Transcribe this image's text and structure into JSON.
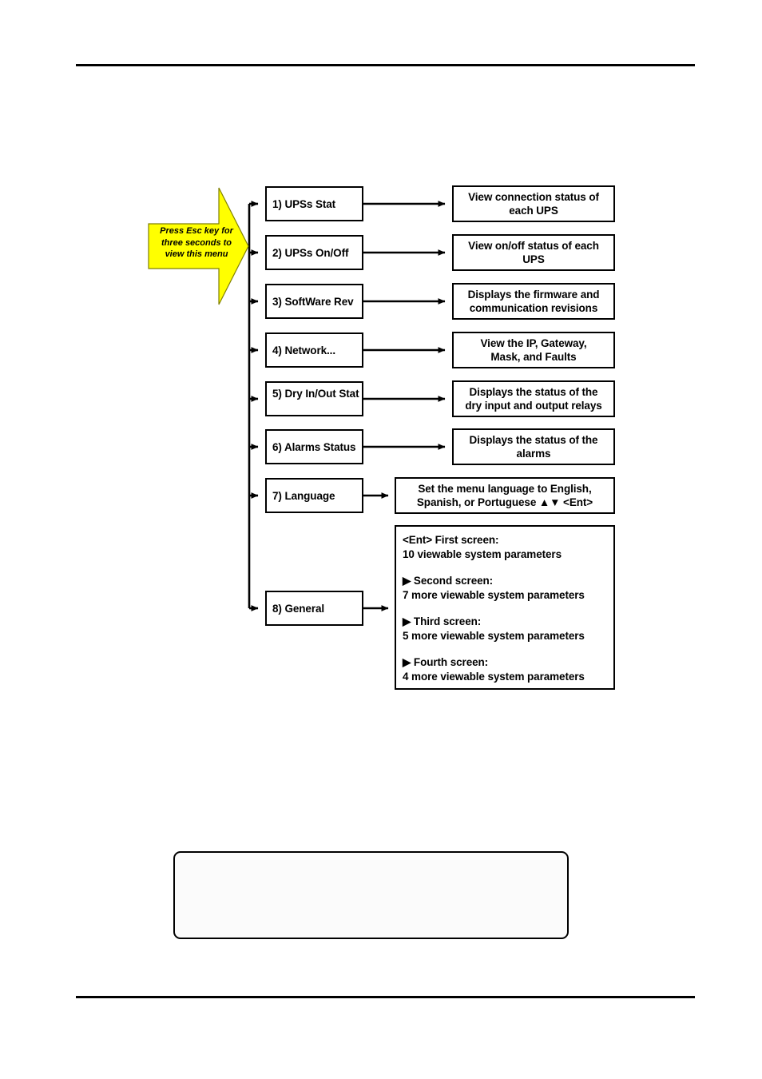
{
  "document": {
    "page_background": "#ffffff",
    "rule_color": "#000000",
    "callout_color": "#FFFF00"
  },
  "callout": {
    "icon": "right-arrow-callout",
    "text_line1": "Press Esc key for",
    "text_line2": "three seconds to",
    "text_line3": "view this menu",
    "fill": "#FFFF00"
  },
  "menu": {
    "items": [
      {
        "label": "1) UPSs Stat",
        "name": "menu-item-upss-stat"
      },
      {
        "label": "2) UPSs On/Off",
        "name": "menu-item-upss-on-off"
      },
      {
        "label": "3) SoftWare Rev",
        "name": "menu-item-software-rev"
      },
      {
        "label": "4) Network...",
        "name": "menu-item-network"
      },
      {
        "label": "5) Dry In/Out Stat",
        "name": "menu-item-dry-in-out-stat"
      },
      {
        "label": "6) Alarms Status",
        "name": "menu-item-alarms-status"
      },
      {
        "label": "7) Language",
        "name": "menu-item-language"
      },
      {
        "label": "8) General",
        "name": "menu-item-general"
      }
    ]
  },
  "descriptions": [
    {
      "line1": "View connection status of",
      "line2": "each UPS"
    },
    {
      "line1": "View on/off status of each",
      "line2": "UPS"
    },
    {
      "line1": "Displays the firmware and",
      "line2": "communication revisions"
    },
    {
      "line1": "View the IP, Gateway,",
      "line2": "Mask, and Faults"
    },
    {
      "line1": "Displays the status of the",
      "line2": "dry input and output relays"
    },
    {
      "line1": "Displays the status of the",
      "line2": "alarms"
    },
    {
      "line1": "Set the menu language to English,",
      "line2": "Spanish, or Portuguese ▲▼ <Ent>"
    }
  ],
  "general_description": {
    "first_header": "<Ent> First screen:",
    "first_detail": "10 viewable system parameters",
    "second_header": "▶ Second screen:",
    "second_detail": "7 more viewable system parameters",
    "third_header": "▶ Third screen:",
    "third_detail": "5 more viewable system parameters",
    "fourth_header": "▶ Fourth screen:",
    "fourth_detail": "4 more viewable system parameters"
  },
  "note_box": {
    "content": ""
  }
}
